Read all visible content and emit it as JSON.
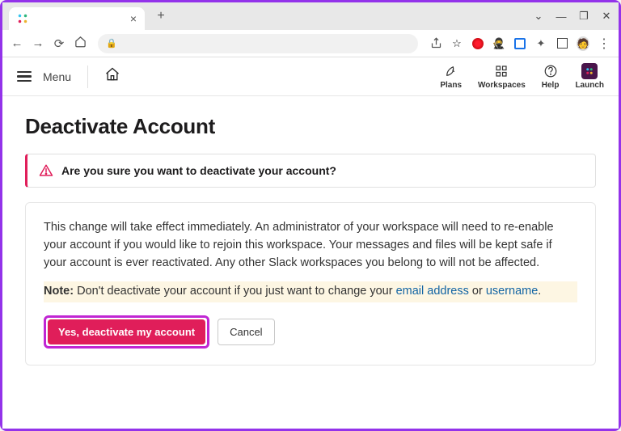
{
  "browser": {
    "tab_title": "",
    "window_controls": {
      "minimize": "—",
      "maximize": "❐",
      "close": "✕",
      "dropdown": "⌄"
    },
    "nav": {
      "back": "←",
      "forward": "→",
      "reload": "⟳"
    }
  },
  "site_header": {
    "menu_label": "Menu",
    "items": [
      {
        "label": "Plans",
        "icon": "rocket-icon"
      },
      {
        "label": "Workspaces",
        "icon": "grid-icon"
      },
      {
        "label": "Help",
        "icon": "help-icon"
      },
      {
        "label": "Launch",
        "icon": "slack-badge"
      }
    ]
  },
  "page": {
    "title": "Deactivate Account",
    "alert": "Are you sure you want to deactivate your account?",
    "body_text": "This change will take effect immediately. An administrator of your workspace will need to re-enable your account if you would like to rejoin this workspace. Your messages and files will be kept safe if your account is ever reactivated. Any other Slack workspaces you belong to will not be affected.",
    "note_label": "Note:",
    "note_pre": " Don't deactivate your account if you just want to change your ",
    "note_link1": "email address",
    "note_mid": " or ",
    "note_link2": "username",
    "note_post": ".",
    "primary_btn": "Yes, deactivate my account",
    "secondary_btn": "Cancel"
  }
}
